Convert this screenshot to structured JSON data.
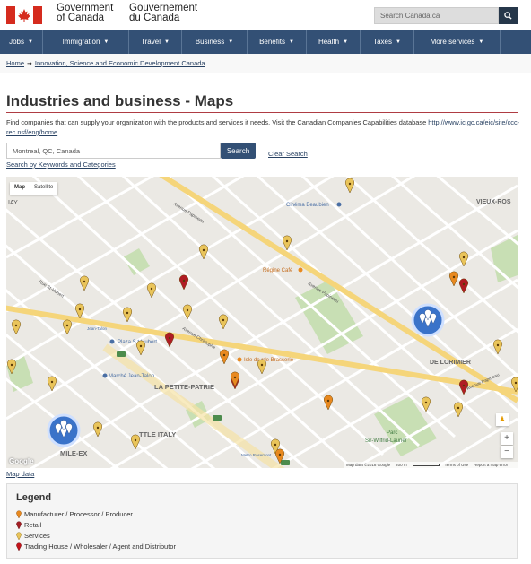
{
  "header": {
    "gov_en": "Government\nof Canada",
    "gov_en_line1": "Government",
    "gov_en_line2": "of Canada",
    "gov_fr_line1": "Gouvernement",
    "gov_fr_line2": "du Canada",
    "search_placeholder": "Search Canada.ca"
  },
  "menu": [
    {
      "label": "Jobs"
    },
    {
      "label": "Immigration"
    },
    {
      "label": "Travel"
    },
    {
      "label": "Business"
    },
    {
      "label": "Benefits"
    },
    {
      "label": "Health"
    },
    {
      "label": "Taxes"
    },
    {
      "label": "More services"
    }
  ],
  "breadcrumb": {
    "home": "Home",
    "item": "Innovation, Science and Economic Development Canada"
  },
  "page": {
    "title": "Industries and business - Maps",
    "intro": "Find companies that can supply your organization with the products and services it needs. Visit the Canadian Companies Capabilities database",
    "intro_link": "http://www.ic.gc.ca/eic/site/ccc-rec.nsf/eng/home",
    "intro_end": "."
  },
  "search": {
    "value": "Montreal, QC, Canada",
    "button": "Search",
    "clear": "Clear Search",
    "keywords_link": "Search by Keywords and Categories"
  },
  "map": {
    "type_map": "Map",
    "type_satellite": "Satellite",
    "labels": {
      "vieux_rosemont": "VIEUX-ROS",
      "la_petite_patrie": "LA PETITE-PATRIE",
      "de_lorimier": "DE LORIMIER",
      "little_italy": "TTLE ITALY",
      "mile_ex": "MILE-EX",
      "parc": "Parc",
      "parc_name": "Sir-Wilfrid-Laurier",
      "cinema": "Cinéma Beaubien",
      "regine": "Régine Café",
      "plaza": "Plaza S   t-Hubert",
      "marche": "Marché Jean-Talon",
      "isle": "Isle de   rde Brasserie",
      "jean_talon": "Jean-Talon",
      "metro_rosemont": "Metro Rosemont",
      "ave_papineau_1": "Avenue Papineau",
      "ave_papineau_2": "Avenue Papineau",
      "ave_papineau_3": "Avenue Papineau",
      "ave_christophe": "Avenue Christophe",
      "rue_st_hubert": "Rue St-Hubert",
      "iay": "IAY"
    },
    "cluster_1": "",
    "cluster_2": "",
    "google": "Google",
    "footer_data": "Map data ©2018 Google",
    "footer_scale": "200 m",
    "footer_terms": "Terms of Use",
    "footer_report": "Report a map error"
  },
  "map_data_link": "Map data",
  "legend": {
    "title": "Legend",
    "items": [
      {
        "label": "Manufacturer / Processor / Producer",
        "color": "#e8891f"
      },
      {
        "label": "Retail",
        "color": "#a31e24"
      },
      {
        "label": "Services",
        "color": "#e9b84a"
      },
      {
        "label": "Trading House / Wholesaler / Agent and Distributor",
        "color": "#c4141b"
      }
    ]
  },
  "colors": {
    "menu_bg": "#335075",
    "title_rule": "#af3c43",
    "pin_services": "#e9c45a",
    "pin_manufacturer": "#e8891f",
    "pin_retail": "#b01c24"
  }
}
